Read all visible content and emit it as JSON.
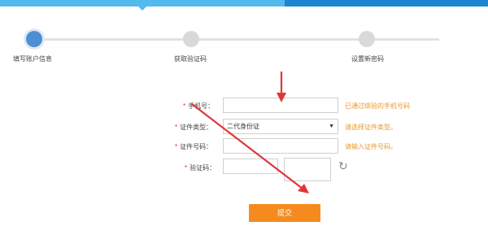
{
  "steps": [
    {
      "label": "填写账户信息",
      "state": "active"
    },
    {
      "label": "获取验证码",
      "state": "inactive"
    },
    {
      "label": "设置新密码",
      "state": "inactive"
    }
  ],
  "form": {
    "required_mark": "*",
    "phone": {
      "label": "手机号：",
      "value": "",
      "hint": "已通过绑验的手机号码"
    },
    "id_type": {
      "label": "证件类型：",
      "selected": "二代身份证",
      "hint": "请选择证件类型。"
    },
    "id_number": {
      "label": "证件号码：",
      "value": "",
      "hint": "请输入证件号码。"
    },
    "captcha": {
      "label": "验证码：",
      "value": ""
    },
    "submit_label": "提交"
  },
  "icons": {
    "refresh": "refresh-icon",
    "dropdown": "caret-down-icon"
  },
  "colors": {
    "topbar_light": "#54b9ec",
    "topbar_dark": "#1a86cf",
    "step_active": "#4e8fd1",
    "step_inactive": "#d9d9d9",
    "required": "#e02b2b",
    "hint": "#e8992f",
    "submit": "#f58b1f",
    "annotation_arrow": "#e0363a"
  }
}
